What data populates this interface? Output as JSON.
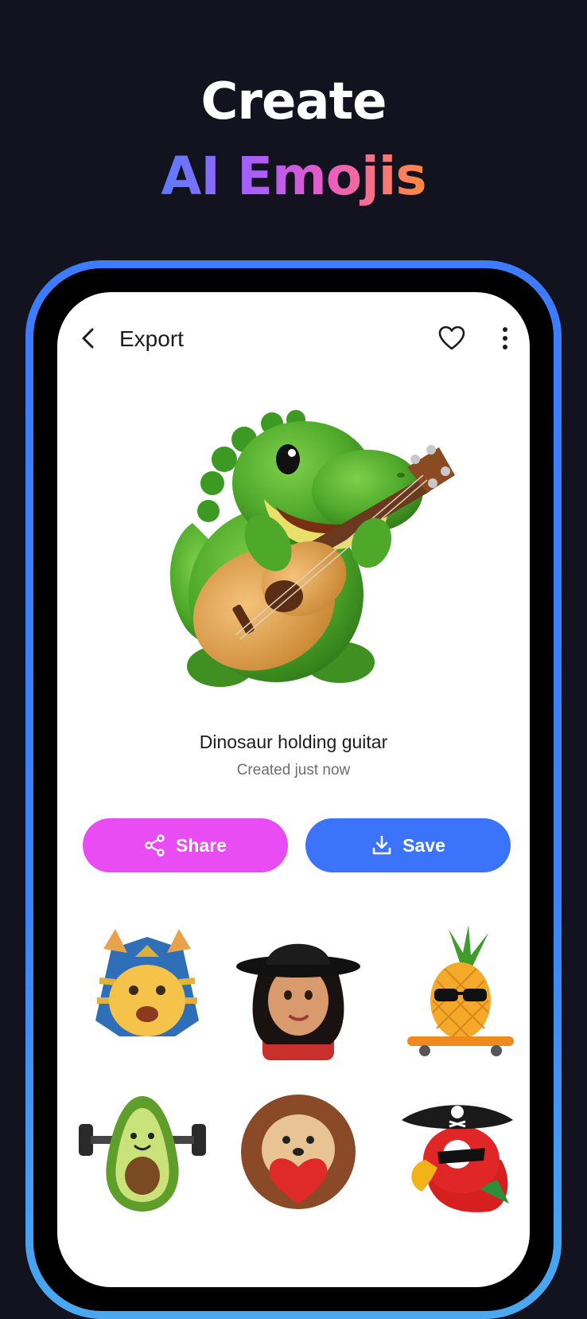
{
  "promo": {
    "headline_line1": "Create",
    "headline_line2": "AI Emojis",
    "gradient": [
      "#5b7cff",
      "#b05cf5",
      "#e85cc7",
      "#ff8a3d"
    ]
  },
  "topbar": {
    "title": "Export",
    "back_icon": "chevron-left-icon",
    "favorite_icon": "heart-outline-icon",
    "more_icon": "more-vertical-icon"
  },
  "emoji": {
    "title": "Dinosaur holding guitar",
    "subtitle": "Created just now"
  },
  "actions": {
    "share_label": "Share",
    "share_icon": "share-icon",
    "share_color": "#e84cf2",
    "save_label": "Save",
    "save_icon": "download-icon",
    "save_color": "#3b73fa"
  },
  "gallery": [
    {
      "name": "pharaoh-cat-emoji"
    },
    {
      "name": "hat-singer-emoji"
    },
    {
      "name": "sunglasses-pineapple-skateboard-emoji"
    },
    {
      "name": "avocado-dumbbells-emoji"
    },
    {
      "name": "hedgehog-heart-emoji"
    },
    {
      "name": "pirate-parrot-emoji"
    }
  ]
}
